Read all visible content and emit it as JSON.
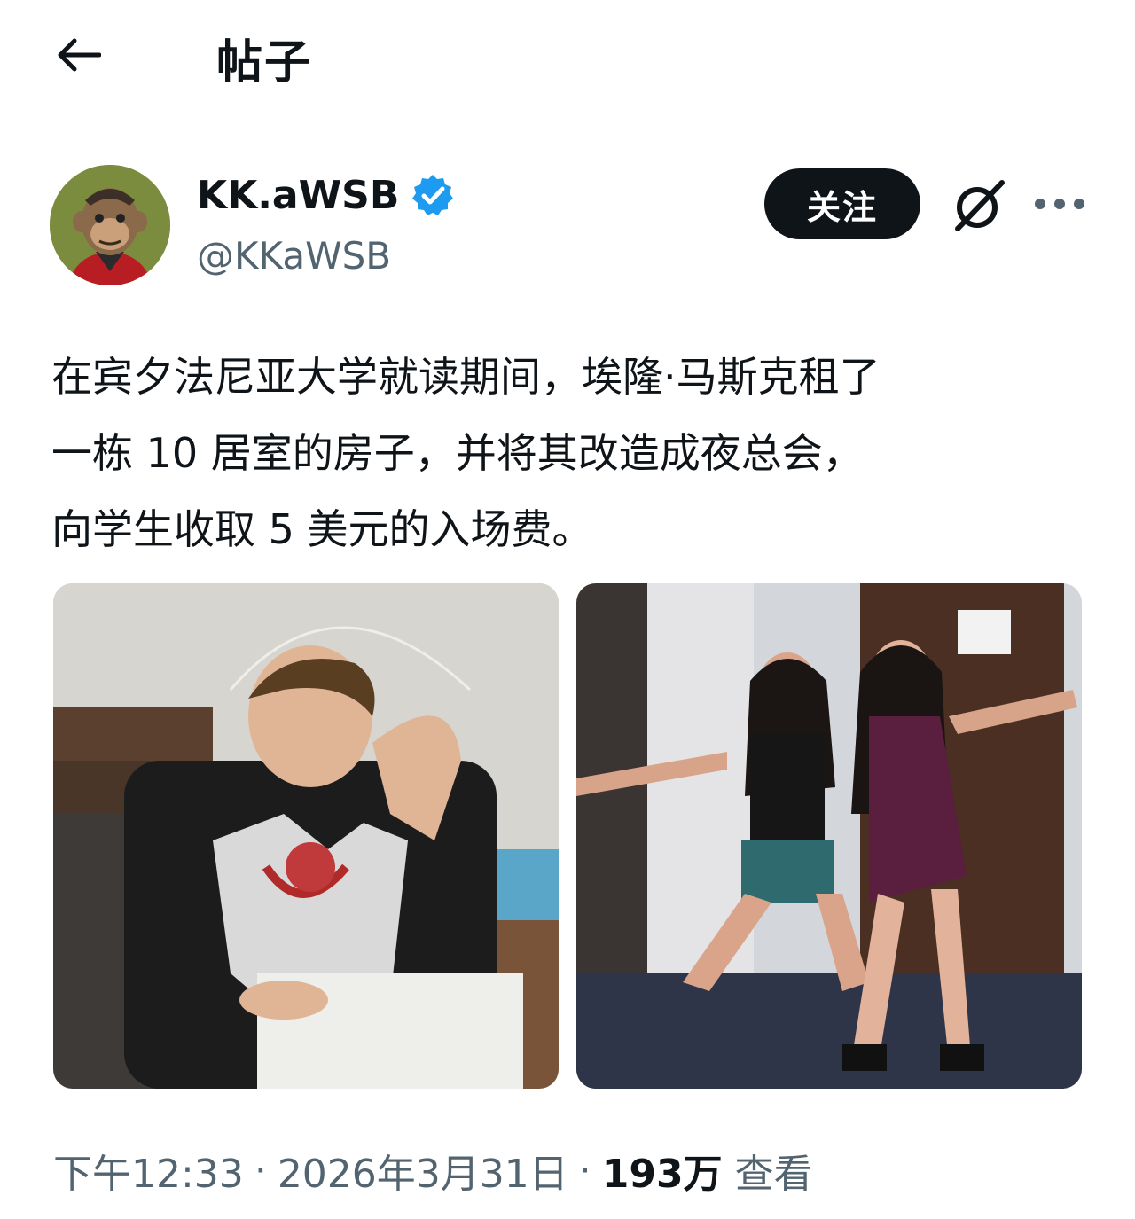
{
  "header": {
    "back_icon": "arrow-left-icon",
    "title": "帖子"
  },
  "author": {
    "display_name": "KK.aWSB",
    "handle": "@KKaWSB",
    "verified_icon": "verified-badge-icon",
    "verified_color": "#1d9bf0",
    "follow_label": "关注",
    "grok_icon": "grok-icon",
    "more_icon": "more-horizontal-icon"
  },
  "tweet": {
    "line1": "在宾夕法尼亚大学就读期间，埃隆·马斯克租了",
    "line2": "一栋 10 居室的房子，并将其改造成夜总会，",
    "line3": "向学生收取 5 美元的入场费。"
  },
  "meta": {
    "time": "下午12:33",
    "separator": "·",
    "date": "2026年3月31日",
    "views_count": "193万",
    "views_label": "查看"
  }
}
